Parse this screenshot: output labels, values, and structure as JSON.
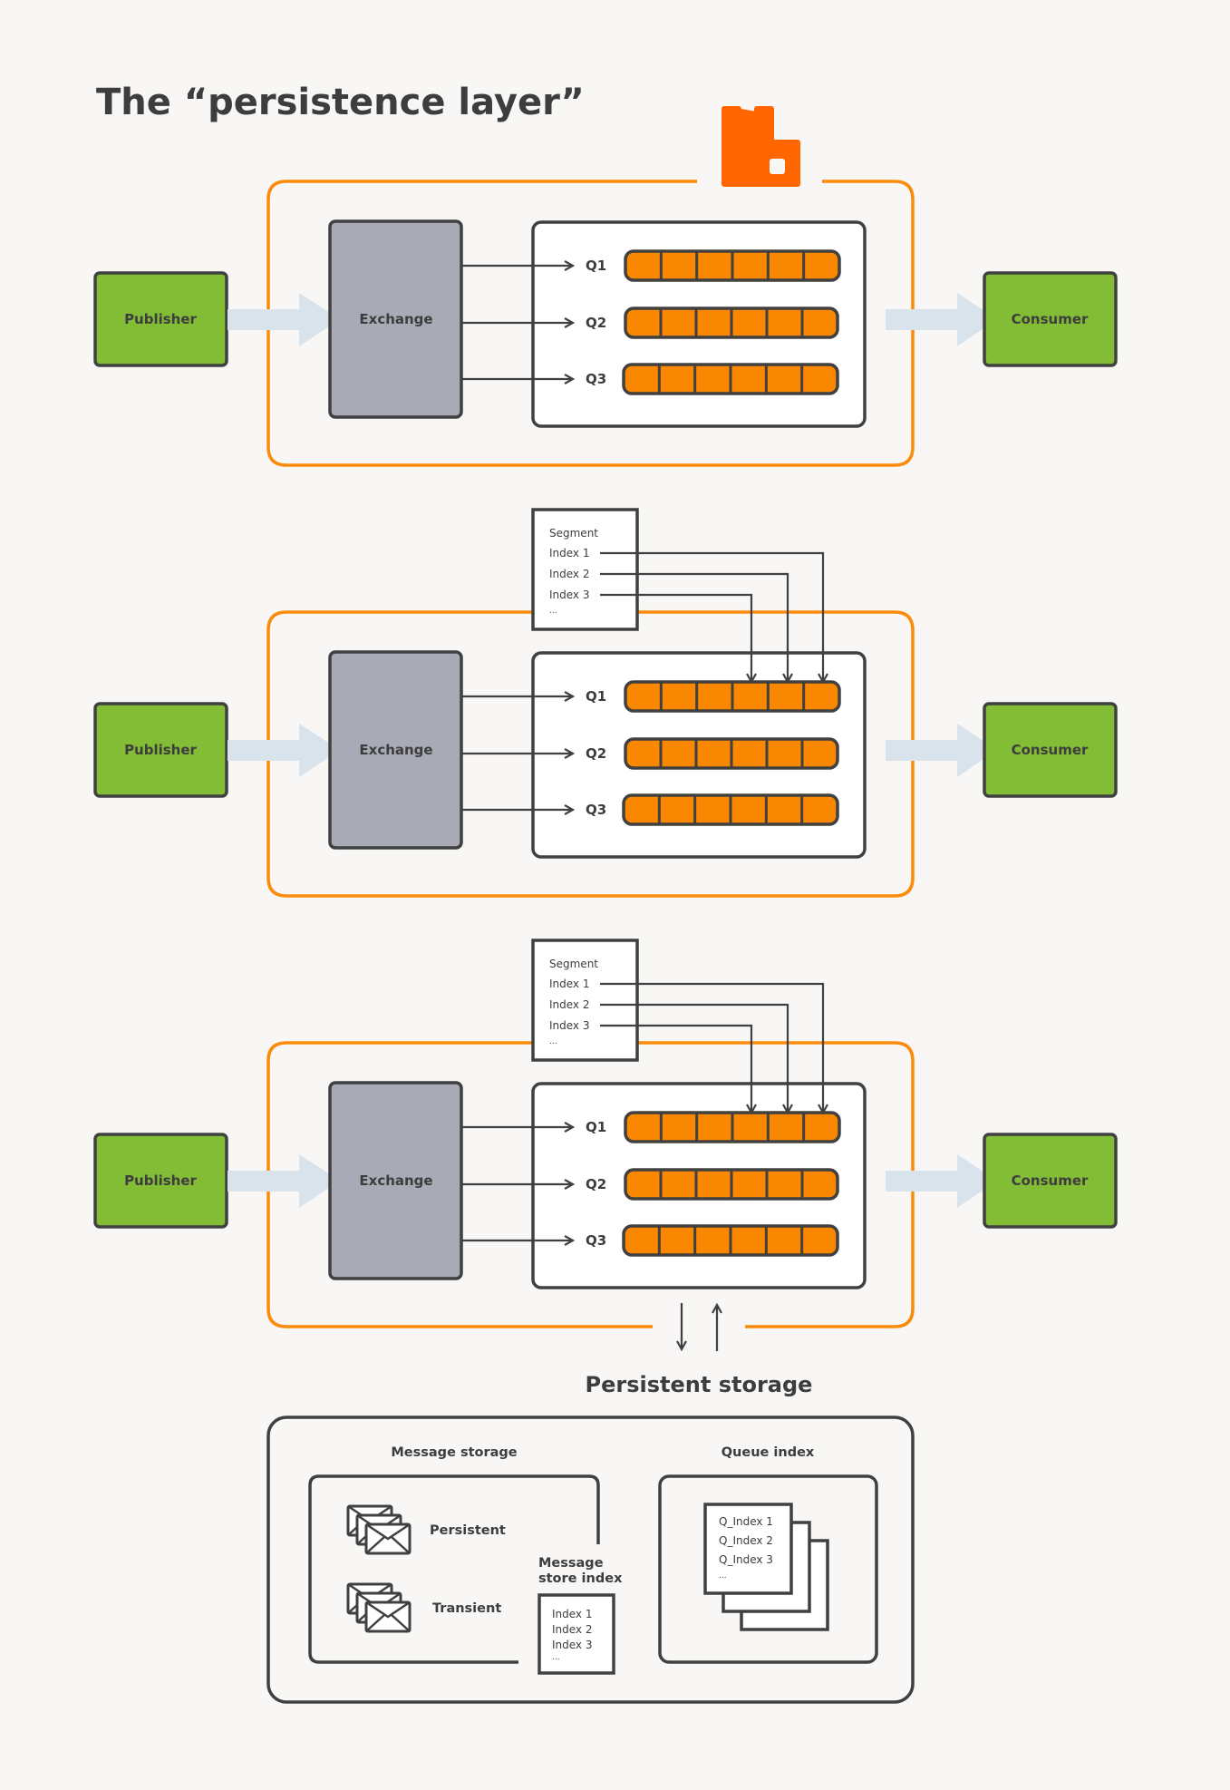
{
  "title": "The “persistence layer”",
  "colors": {
    "background": "#f8f7f5",
    "ink": "#404040",
    "broker_frame": "#fb8b0a",
    "logo": "#ff6600",
    "queue_fill": "#f98800",
    "endpoint_fill": "#83bd36",
    "exchange_fill": "#a8abb6",
    "flow_arrow": "#d9e3ec",
    "panel_fill": "#ffffff"
  },
  "logo": {
    "icon": "rabbitmq-logo-icon"
  },
  "diagrams": [
    {
      "publisher": "Publisher",
      "exchange": "Exchange",
      "consumer": "Consumer",
      "queues": [
        {
          "label": "Q1",
          "slots": 6
        },
        {
          "label": "Q2",
          "slots": 6
        },
        {
          "label": "Q3",
          "slots": 6
        }
      ],
      "segment": null,
      "storage_arrows": false
    },
    {
      "publisher": "Publisher",
      "exchange": "Exchange",
      "consumer": "Consumer",
      "queues": [
        {
          "label": "Q1",
          "slots": 6
        },
        {
          "label": "Q2",
          "slots": 6
        },
        {
          "label": "Q3",
          "slots": 6
        }
      ],
      "segment": {
        "heading": "Segment",
        "entries": [
          "Index 1",
          "Index 2",
          "Index 3"
        ],
        "ellipsis": "...",
        "targets": [
          {
            "queue": "Q1",
            "slot": 6
          },
          {
            "queue": "Q1",
            "slot": 5
          },
          {
            "queue": "Q1",
            "slot": 4
          }
        ]
      },
      "storage_arrows": false
    },
    {
      "publisher": "Publisher",
      "exchange": "Exchange",
      "consumer": "Consumer",
      "queues": [
        {
          "label": "Q1",
          "slots": 6
        },
        {
          "label": "Q2",
          "slots": 6
        },
        {
          "label": "Q3",
          "slots": 6
        }
      ],
      "segment": {
        "heading": "Segment",
        "entries": [
          "Index 1",
          "Index 2",
          "Index 3"
        ],
        "ellipsis": "...",
        "targets": [
          {
            "queue": "Q1",
            "slot": 6
          },
          {
            "queue": "Q1",
            "slot": 5
          },
          {
            "queue": "Q1",
            "slot": 4
          }
        ]
      },
      "storage_arrows": true
    }
  ],
  "persistent_storage": {
    "heading": "Persistent storage",
    "message_storage": {
      "heading": "Message storage",
      "groups": [
        {
          "label": "Persistent",
          "icon": "envelopes-icon"
        },
        {
          "label": "Transient",
          "icon": "envelopes-icon"
        }
      ],
      "store_index": {
        "heading_line1": "Message",
        "heading_line2": "store index",
        "entries": [
          "Index 1",
          "Index 2",
          "Index 3"
        ],
        "ellipsis": "..."
      }
    },
    "queue_index": {
      "heading": "Queue index",
      "entries": [
        "Q_Index 1",
        "Q_Index 2",
        "Q_Index 3"
      ],
      "ellipsis": "..."
    }
  }
}
